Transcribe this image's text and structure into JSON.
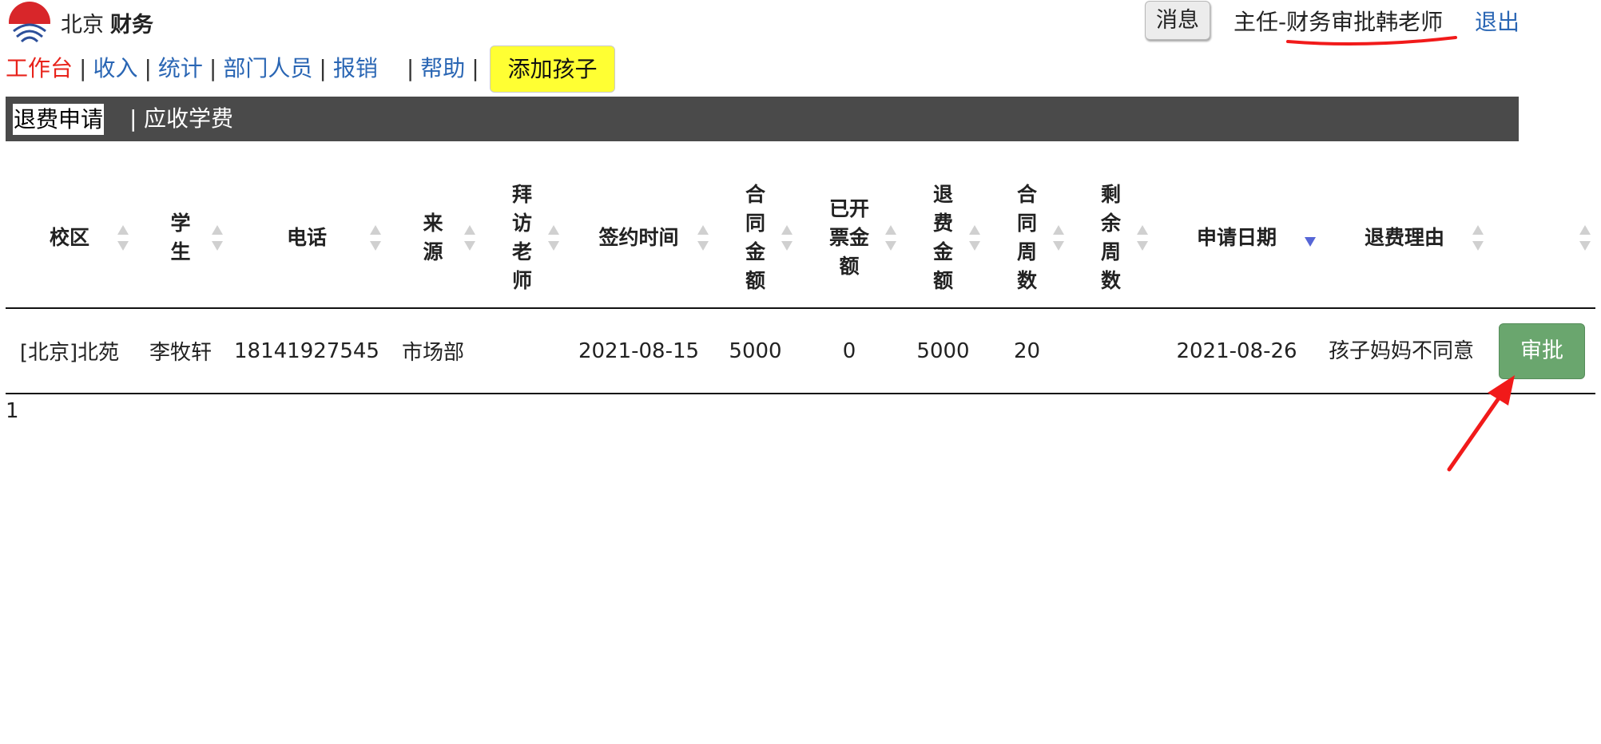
{
  "brand": {
    "city": "北京",
    "name": "财务"
  },
  "header": {
    "message_button": "消息",
    "user_role": "主任-财务审批韩老师",
    "logout": "退出"
  },
  "nav": {
    "items": [
      "工作台",
      "收入",
      "统计",
      "部门人员",
      "报销",
      "帮助"
    ],
    "separator": "|",
    "add_child_button": "添加孩子"
  },
  "subnav": {
    "tabs": [
      "退费申请",
      "应收学费"
    ],
    "separator": "|",
    "active": "退费申请"
  },
  "table": {
    "columns": [
      {
        "label": "校区",
        "lines": [
          "校区"
        ]
      },
      {
        "label": "学生",
        "lines": [
          "学",
          "生"
        ]
      },
      {
        "label": "电话",
        "lines": [
          "电话"
        ]
      },
      {
        "label": "来源",
        "lines": [
          "来",
          "源"
        ]
      },
      {
        "label": "拜访老师",
        "lines": [
          "拜",
          "访",
          "老",
          "师"
        ]
      },
      {
        "label": "签约时间",
        "lines": [
          "签约时间"
        ]
      },
      {
        "label": "合同金额",
        "lines": [
          "合",
          "同",
          "金",
          "额"
        ]
      },
      {
        "label": "已开票金额",
        "lines": [
          "已开",
          "票金",
          "额"
        ]
      },
      {
        "label": "退费金额",
        "lines": [
          "退",
          "费",
          "金",
          "额"
        ]
      },
      {
        "label": "合同周数",
        "lines": [
          "合",
          "同",
          "周",
          "数"
        ]
      },
      {
        "label": "剩余周数",
        "lines": [
          "剩",
          "余",
          "周",
          "数"
        ]
      },
      {
        "label": "申请日期",
        "lines": [
          "申请日期"
        ],
        "sorted": "desc"
      },
      {
        "label": "退费理由",
        "lines": [
          "退费理由"
        ]
      },
      {
        "label": "",
        "lines": []
      }
    ],
    "rows": [
      {
        "campus": "[北京]北苑",
        "student": "李牧轩",
        "phone": "18141927545",
        "source": "市场部",
        "visit_teacher": "",
        "sign_date": "2021-08-15",
        "contract_amount": "5000",
        "invoiced_amount": "0",
        "refund_amount": "5000",
        "contract_weeks": "20",
        "remaining_weeks": "",
        "apply_date": "2021-08-26",
        "reason": "孩子妈妈不同意",
        "action": "审批"
      }
    ]
  },
  "pager": {
    "current": "1"
  },
  "colors": {
    "link": "#2a66b4",
    "active_nav": "#e8231b",
    "subnav_bg": "#4a4a4a",
    "add_child_bg": "#ffff33",
    "approve_bg": "#6aa66e",
    "annotation": "#f11a1a"
  },
  "icons": {
    "logo": "school-logo-icon",
    "sort": "sort-arrows-icon"
  }
}
